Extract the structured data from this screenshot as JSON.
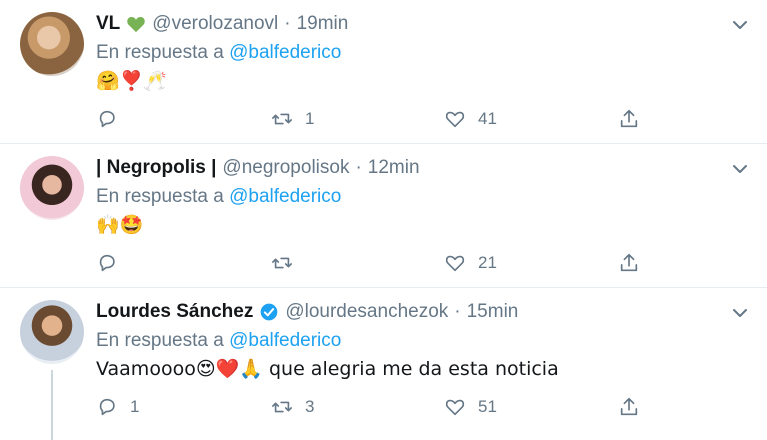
{
  "tweets": [
    {
      "name": "VL",
      "handle": "@verolozanovl",
      "separator": "·",
      "time": "19min",
      "reply_prefix": "En respuesta a",
      "reply_mention": "@balfederico",
      "text": "🤗❣️🥂",
      "reply_count": "",
      "retweet_count": "1",
      "like_count": "41",
      "has_green_heart": true,
      "verified": false
    },
    {
      "name": "| Negropolis |",
      "handle": "@negropolisok",
      "separator": "·",
      "time": "12min",
      "reply_prefix": "En respuesta a",
      "reply_mention": "@balfederico",
      "text": "🙌🤩",
      "reply_count": "",
      "retweet_count": "",
      "like_count": "21",
      "has_green_heart": false,
      "verified": false
    },
    {
      "name": "Lourdes Sánchez",
      "handle": "@lourdesanchezok",
      "separator": "·",
      "time": "15min",
      "reply_prefix": "En respuesta a",
      "reply_mention": "@balfederico",
      "text": "Vaamoooo😍❤️🙏 que alegria me da esta noticia",
      "reply_count": "1",
      "retweet_count": "3",
      "like_count": "51",
      "has_green_heart": false,
      "verified": true
    }
  ],
  "colors": {
    "accent": "#1da1f2",
    "muted": "#657786",
    "text": "#14171a",
    "divider": "#e6ecf0",
    "green_heart": "#77b255"
  }
}
